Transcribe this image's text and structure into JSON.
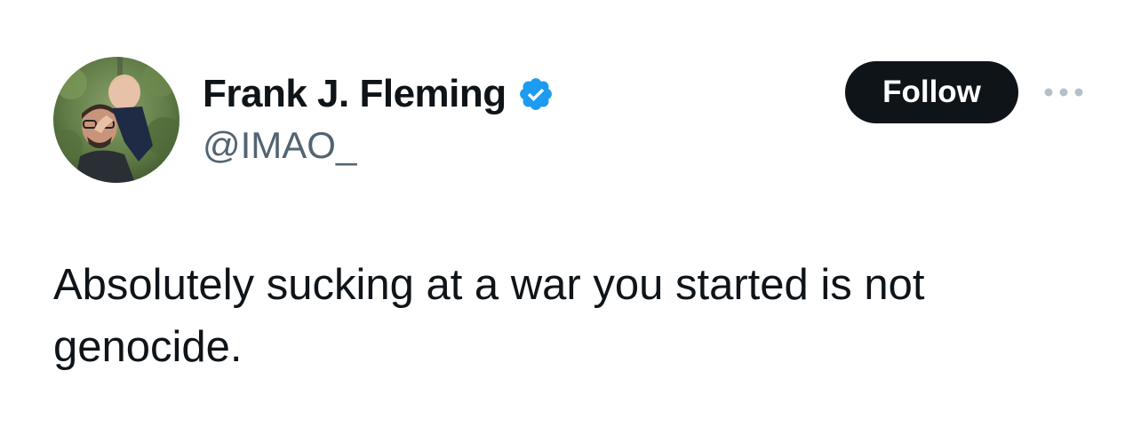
{
  "author": {
    "display_name": "Frank J. Fleming",
    "handle": "@IMAO_",
    "verified_icon": "verified-badge-icon",
    "avatar_description": "avatar-photo"
  },
  "actions": {
    "follow_label": "Follow",
    "more_icon": "more-horizontal-icon"
  },
  "tweet": {
    "text": "Absolutely sucking at a war you started is not genocide."
  },
  "colors": {
    "text_primary": "#0f1419",
    "text_secondary": "#536471",
    "verified_blue": "#1d9bf0",
    "follow_bg": "#0f1419",
    "follow_text": "#ffffff",
    "more_icon": "#b8c0c7"
  }
}
